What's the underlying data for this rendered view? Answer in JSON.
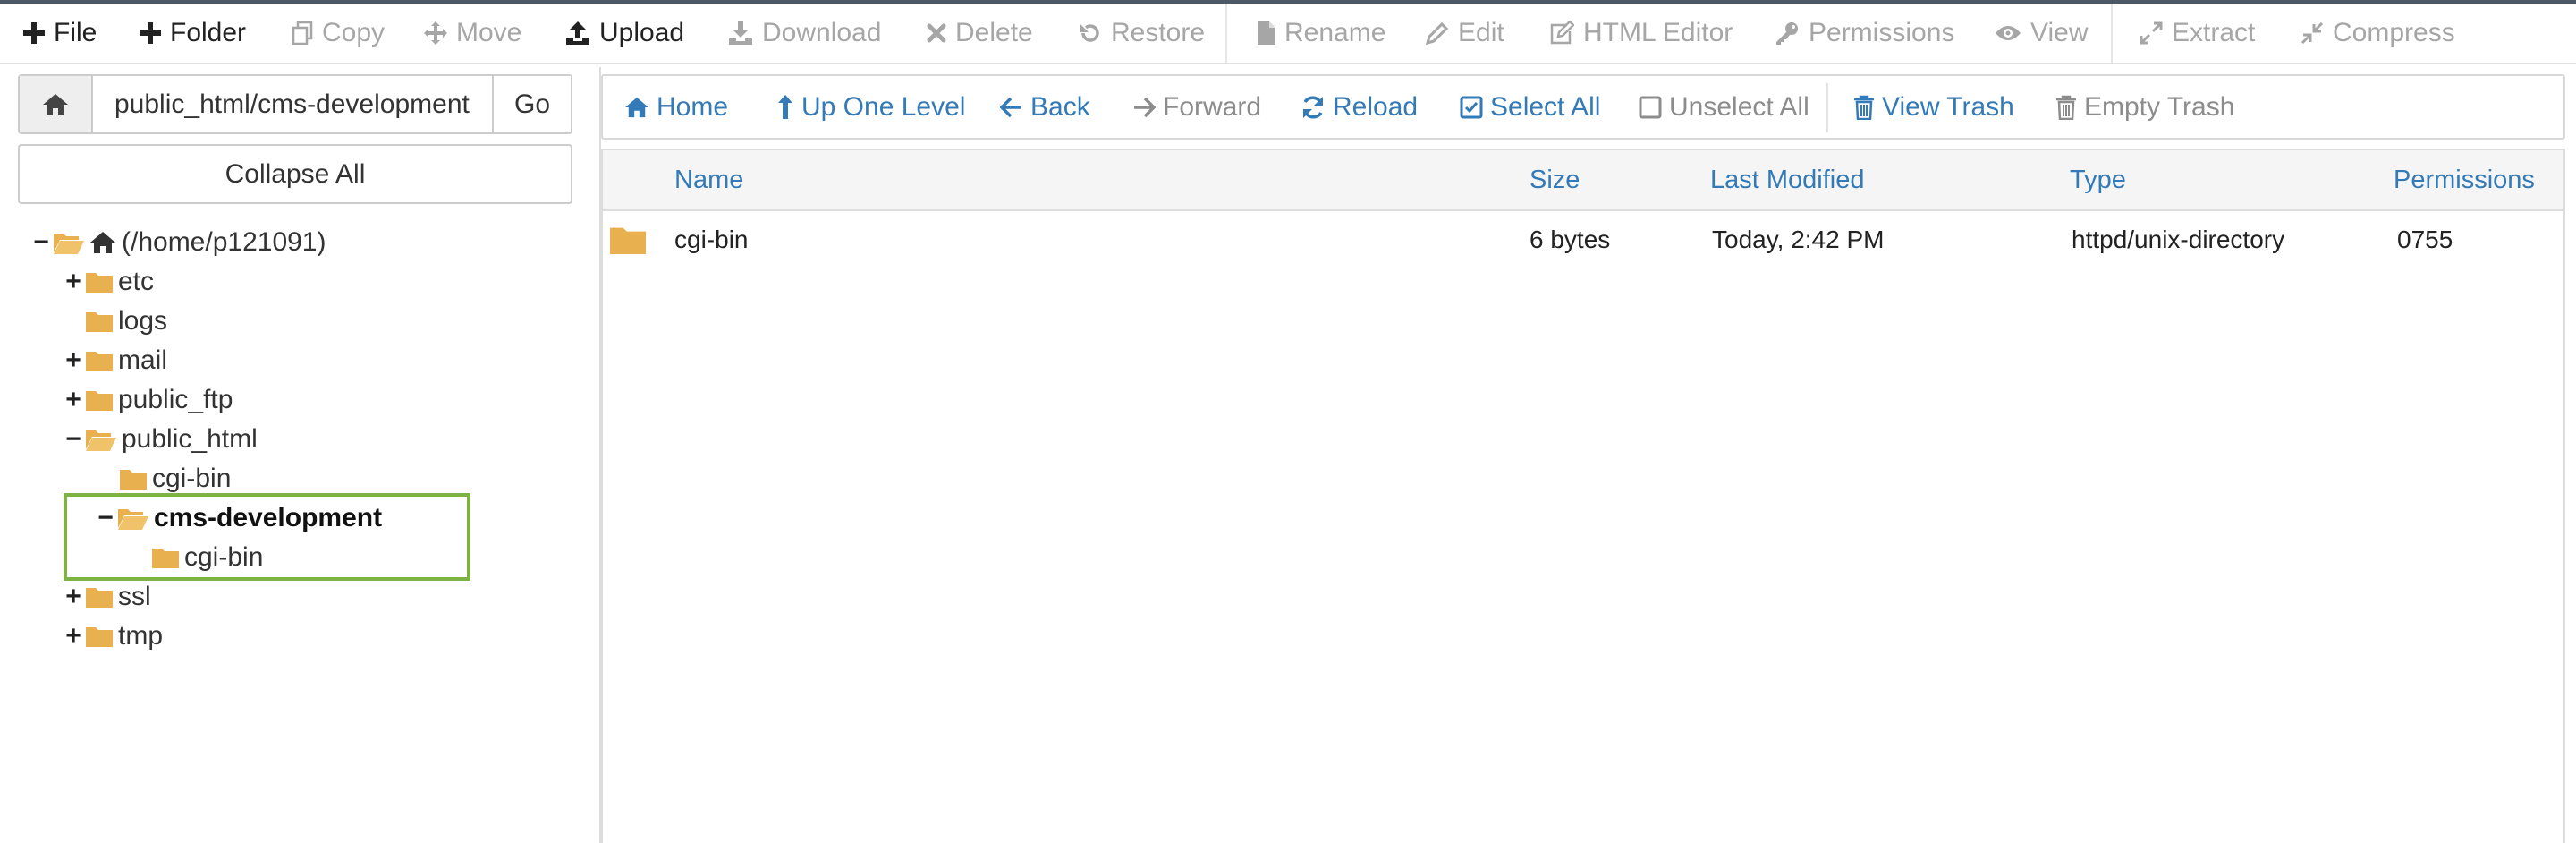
{
  "toolbar": {
    "file": "File",
    "folder": "Folder",
    "copy": "Copy",
    "move": "Move",
    "upload": "Upload",
    "download": "Download",
    "delete": "Delete",
    "restore": "Restore",
    "rename": "Rename",
    "edit": "Edit",
    "html_editor": "HTML Editor",
    "permissions": "Permissions",
    "view": "View",
    "extract": "Extract",
    "compress": "Compress"
  },
  "path": {
    "value": "public_html/cms-development",
    "go": "Go"
  },
  "collapse_all": "Collapse All",
  "tree": {
    "root": "(/home/p121091)",
    "etc": "etc",
    "logs": "logs",
    "mail": "mail",
    "public_ftp": "public_ftp",
    "public_html": "public_html",
    "public_html_cgi": "cgi-bin",
    "cms_development": "cms-development",
    "cms_cgi": "cgi-bin",
    "ssl": "ssl",
    "tmp": "tmp"
  },
  "nav": {
    "home": "Home",
    "up": "Up One Level",
    "back": "Back",
    "forward": "Forward",
    "reload": "Reload",
    "select_all": "Select All",
    "unselect_all": "Unselect All",
    "view_trash": "View Trash",
    "empty_trash": "Empty Trash"
  },
  "table": {
    "headers": {
      "name": "Name",
      "size": "Size",
      "modified": "Last Modified",
      "type": "Type",
      "permissions": "Permissions"
    },
    "rows": [
      {
        "name": "cgi-bin",
        "size": "6 bytes",
        "modified": "Today, 2:42 PM",
        "type": "httpd/unix-directory",
        "permissions": "0755"
      }
    ]
  },
  "colors": {
    "link_blue": "#337ab7",
    "folder": "#e8b04e",
    "highlight": "#7cb342"
  }
}
